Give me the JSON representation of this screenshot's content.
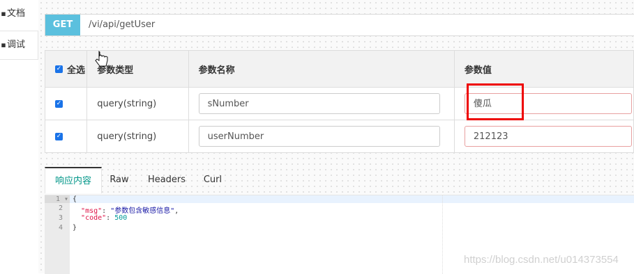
{
  "sidebar": {
    "doc_label": "文档",
    "debug_label": "调试"
  },
  "request": {
    "method": "GET",
    "url": "/vi/api/getUser"
  },
  "params_table": {
    "headers": {
      "select_all": "全选",
      "type": "参数类型",
      "name": "参数名称",
      "value": "参数值"
    },
    "rows": [
      {
        "type": "query(string)",
        "name": "sNumber",
        "value": "傻瓜",
        "checked": true
      },
      {
        "type": "query(string)",
        "name": "userNumber",
        "value": "212123",
        "checked": true
      }
    ]
  },
  "response_tabs": [
    "响应内容",
    "Raw",
    "Headers",
    "Curl"
  ],
  "code": {
    "line_numbers": [
      "1",
      "2",
      "3",
      "4"
    ],
    "lines": [
      "{",
      "\"msg\": \"参数包含敏感信息\",",
      "\"code\": 500",
      "}"
    ],
    "msg_key": "\"msg\"",
    "msg_val": "\"参数包含敏感信息\"",
    "code_key": "\"code\"",
    "code_val": "500"
  },
  "watermark": "https://blog.csdn.net/u014373554",
  "colors": {
    "method_bg": "#5bc0de",
    "active_tab": "#009688",
    "highlight": "#ee0000",
    "checkbox": "#1a73e8"
  }
}
